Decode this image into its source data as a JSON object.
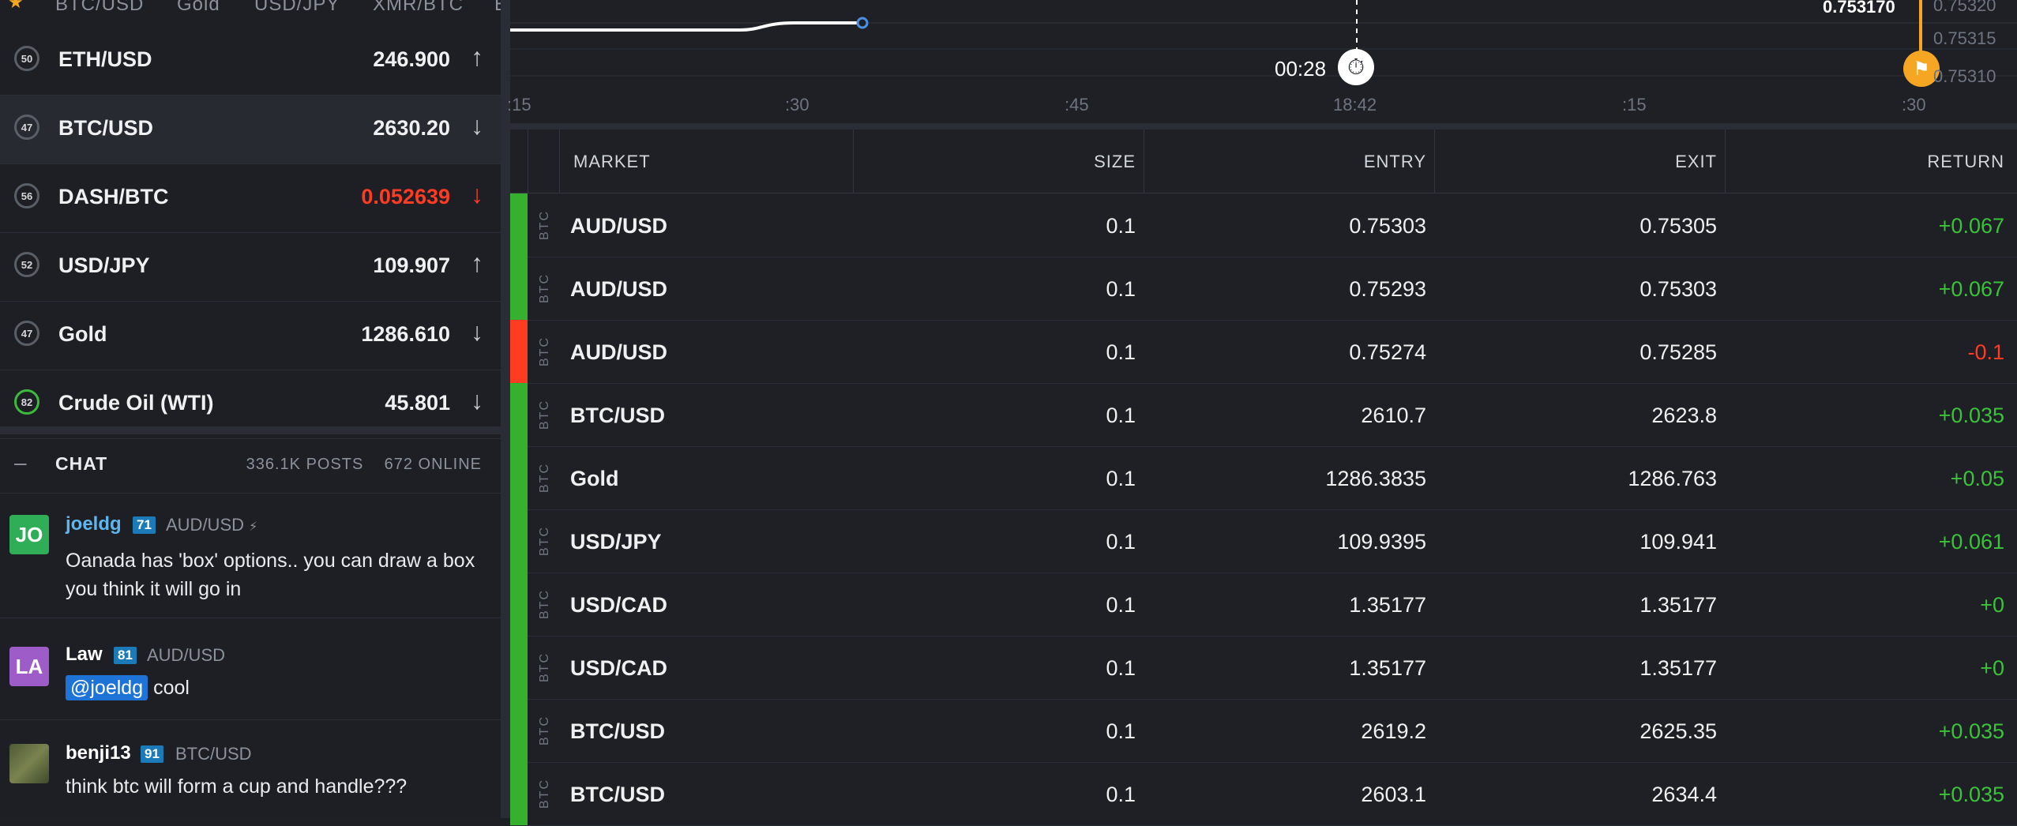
{
  "top_tabs": [
    "BTC/USD",
    "Gold",
    "USD/JPY",
    "XMR/BTC",
    "E"
  ],
  "markets": [
    {
      "level": "50",
      "name": "ETH/USD",
      "price": "246.900",
      "direction": "up",
      "red": false,
      "selected": false
    },
    {
      "level": "47",
      "name": "BTC/USD",
      "price": "2630.20",
      "direction": "down",
      "red": false,
      "selected": true
    },
    {
      "level": "56",
      "name": "DASH/BTC",
      "price": "0.052639",
      "direction": "down",
      "red": true,
      "selected": false
    },
    {
      "level": "52",
      "name": "USD/JPY",
      "price": "109.907",
      "direction": "up",
      "red": false,
      "selected": false
    },
    {
      "level": "47",
      "name": "Gold",
      "price": "1286.610",
      "direction": "down",
      "red": false,
      "selected": false
    },
    {
      "level": "82",
      "name": "Crude Oil (WTI)",
      "price": "45.801",
      "direction": "down",
      "red": false,
      "selected": false
    }
  ],
  "chat": {
    "minus": "–",
    "title": "CHAT",
    "posts": "336.1K POSTS",
    "online": "672 ONLINE",
    "messages": [
      {
        "initials": "JO",
        "avatar_color": "#2fae57",
        "user": "joeldg",
        "user_color": "#5fb6ef",
        "level": "71",
        "market": "AUD/USD",
        "text": "Oanada has 'box' options.. you can draw a box you think it will go in"
      },
      {
        "initials": "LA",
        "avatar_color": "#9d5cc8",
        "user": "Law",
        "user_color": "#ffffff",
        "level": "81",
        "market": "AUD/USD",
        "mention": "@joeldg",
        "text": "cool"
      },
      {
        "initials": "",
        "avatar_color": "#5a6a3c",
        "user": "benji13",
        "user_color": "#ffffff",
        "level": "91",
        "market": "BTC/USD",
        "text": "think btc will form a cup and handle???"
      }
    ]
  },
  "chart": {
    "x_ticks": [
      ":15",
      ":30",
      ":45",
      "18:42",
      ":15",
      ":30"
    ],
    "y_ticks": [
      "0.75320",
      "0.75315",
      "0.75310"
    ],
    "price_label": "0.753170",
    "timer": "00:28"
  },
  "table": {
    "headers": {
      "market": "MARKET",
      "size": "SIZE",
      "entry": "ENTRY",
      "exit": "EXIT",
      "return": "RETURN"
    },
    "rows": [
      {
        "status": "green",
        "currency": "BTC",
        "market": "AUD/USD",
        "size": "0.1",
        "entry": "0.75303",
        "exit": "0.75305",
        "return": "+0.067"
      },
      {
        "status": "green",
        "currency": "BTC",
        "market": "AUD/USD",
        "size": "0.1",
        "entry": "0.75293",
        "exit": "0.75303",
        "return": "+0.067"
      },
      {
        "status": "red",
        "currency": "BTC",
        "market": "AUD/USD",
        "size": "0.1",
        "entry": "0.75274",
        "exit": "0.75285",
        "return": "-0.1"
      },
      {
        "status": "green",
        "currency": "BTC",
        "market": "BTC/USD",
        "size": "0.1",
        "entry": "2610.7",
        "exit": "2623.8",
        "return": "+0.035"
      },
      {
        "status": "green",
        "currency": "BTC",
        "market": "Gold",
        "size": "0.1",
        "entry": "1286.3835",
        "exit": "1286.763",
        "return": "+0.05"
      },
      {
        "status": "green",
        "currency": "BTC",
        "market": "USD/JPY",
        "size": "0.1",
        "entry": "109.9395",
        "exit": "109.941",
        "return": "+0.061"
      },
      {
        "status": "green",
        "currency": "BTC",
        "market": "USD/CAD",
        "size": "0.1",
        "entry": "1.35177",
        "exit": "1.35177",
        "return": "+0"
      },
      {
        "status": "green",
        "currency": "BTC",
        "market": "USD/CAD",
        "size": "0.1",
        "entry": "1.35177",
        "exit": "1.35177",
        "return": "+0"
      },
      {
        "status": "green",
        "currency": "BTC",
        "market": "BTC/USD",
        "size": "0.1",
        "entry": "2619.2",
        "exit": "2625.35",
        "return": "+0.035"
      },
      {
        "status": "green",
        "currency": "BTC",
        "market": "BTC/USD",
        "size": "0.1",
        "entry": "2603.1",
        "exit": "2634.4",
        "return": "+0.035"
      }
    ]
  },
  "colors": {
    "green": "#35b02f",
    "red": "#ff3b22",
    "accent_orange": "#f5a623",
    "link_blue": "#5fb6ef"
  }
}
